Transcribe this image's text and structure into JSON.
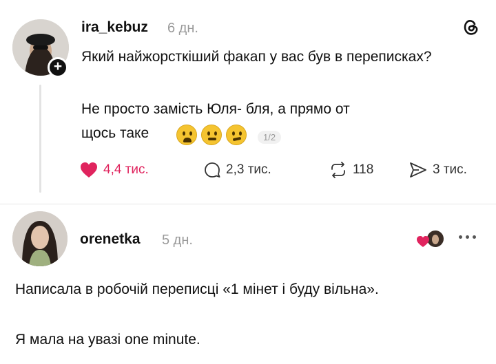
{
  "post": {
    "username": "ira_kebuz",
    "time": "6 дн.",
    "text_line1": "Який найжорсткіший факап у вас був в переписках?",
    "text_line2": "Не просто замість Юля- бля, а прямо от щось таке",
    "text_line3": "щось таке",
    "page_indicator": "1/2",
    "actions": {
      "likes": "4,4 тис.",
      "comments": "2,3 тис.",
      "reposts": "118",
      "shares": "3 тис."
    }
  },
  "reply": {
    "username": "orenetka",
    "time": "5 дн.",
    "text_line1": "Написала в робочій переписці «1 мінет і буду вільна».",
    "text_line2": "Я мала на увазі one minute."
  },
  "colors": {
    "like": "#e0245e",
    "text": "#111111",
    "muted": "#9a9a9a"
  },
  "icons": [
    "threads-logo-icon",
    "plus-icon",
    "heart-icon",
    "comment-icon",
    "repost-icon",
    "share-icon",
    "more-icon"
  ]
}
